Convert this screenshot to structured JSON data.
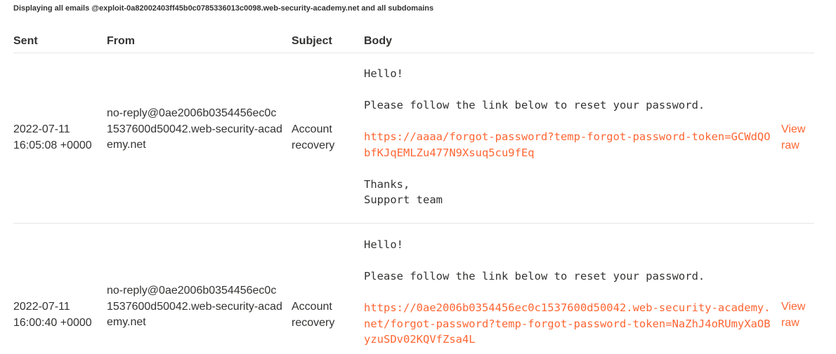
{
  "banner": "Displaying all emails @exploit-0a82002403ff45b0c0785336013c0098.web-security-academy.net and all subdomains",
  "headers": {
    "sent": "Sent",
    "from": "From",
    "subject": "Subject",
    "body": "Body"
  },
  "emails": [
    {
      "sent_date": "2022-07-11",
      "sent_time": "16:05:08 +0000",
      "from": "no-reply@0ae2006b0354456ec0c1537600d50042.web-security-academy.net",
      "subject": "Account recovery",
      "greeting": "Hello!",
      "instruction": "Please follow the link below to reset your password.",
      "link": "https://aaaa/forgot-password?temp-forgot-password-token=GCWdQObfKJqEMLZu477N9Xsuq5cu9fEq",
      "signoff": "Thanks,",
      "signature": "Support team",
      "view_raw": "View raw"
    },
    {
      "sent_date": "2022-07-11",
      "sent_time": "16:00:40 +0000",
      "from": "no-reply@0ae2006b0354456ec0c1537600d50042.web-security-academy.net",
      "subject": "Account recovery",
      "greeting": "Hello!",
      "instruction": "Please follow the link below to reset your password.",
      "link": "https://0ae2006b0354456ec0c1537600d50042.web-security-academy.net/forgot-password?temp-forgot-password-token=NaZhJ4oRUmyXaOByzuSDv02KQVfZsa4L",
      "view_raw": "View raw"
    }
  ],
  "colors": {
    "text": "#333332",
    "link": "#ff6633",
    "divider": "#e6e6e6"
  }
}
